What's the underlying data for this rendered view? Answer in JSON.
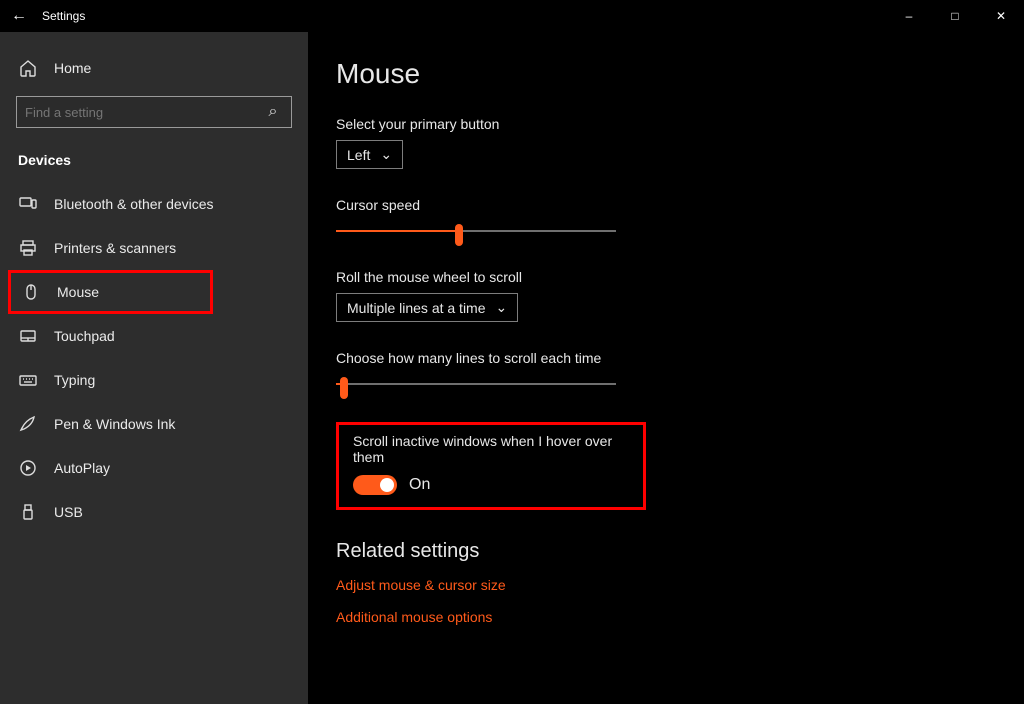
{
  "titlebar": {
    "title": "Settings"
  },
  "sidebar": {
    "home": "Home",
    "search_placeholder": "Find a setting",
    "section": "Devices",
    "items": [
      {
        "label": "Bluetooth & other devices"
      },
      {
        "label": "Printers & scanners"
      },
      {
        "label": "Mouse"
      },
      {
        "label": "Touchpad"
      },
      {
        "label": "Typing"
      },
      {
        "label": "Pen & Windows Ink"
      },
      {
        "label": "AutoPlay"
      },
      {
        "label": "USB"
      }
    ]
  },
  "page": {
    "title": "Mouse",
    "primary": {
      "label": "Select your primary button",
      "value": "Left"
    },
    "cursor_speed": {
      "label": "Cursor speed",
      "percent": 44
    },
    "wheel": {
      "label": "Roll the mouse wheel to scroll",
      "value": "Multiple lines at a time"
    },
    "lines": {
      "label": "Choose how many lines to scroll each time",
      "percent": 3
    },
    "scroll_inactive": {
      "label": "Scroll inactive windows when I hover over them",
      "state": "On"
    },
    "related": {
      "heading": "Related settings",
      "links": [
        "Adjust mouse & cursor size",
        "Additional mouse options"
      ]
    }
  }
}
